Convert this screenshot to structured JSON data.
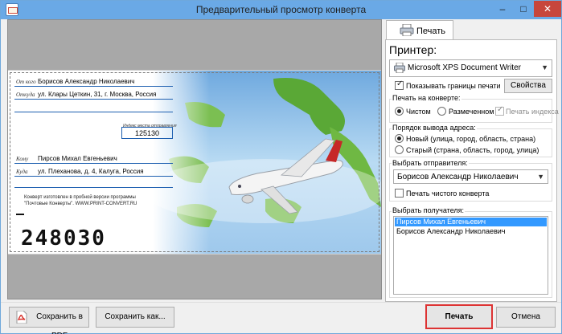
{
  "window": {
    "title": "Предварительный просмотр конверта",
    "minimize": "–",
    "maximize": "□",
    "close": "✕"
  },
  "envelope": {
    "from_label": "От кого",
    "from_value": "Борисов Александр Николаевич",
    "from_where_label": "Откуда",
    "from_where_value": "ул. Клары Цеткин, 31, г. Москва, Россия",
    "index_hint": "Индекс места отправления",
    "index_value": "125130",
    "to_label": "Кому",
    "to_value": "Пирсов Михал Евгеньевич",
    "to_where_label": "Куда",
    "to_where_value": "ул. Плеханова, д. 4, Калуга, Россия",
    "note_line1": "Конверт изготовлен в пробной версии программы",
    "note_line2": "\"Почтовые Конверты\". WWW.PRINT-CONVERT.RU",
    "postcode": "248030"
  },
  "tab": {
    "label": "Печать"
  },
  "printer": {
    "label": "Принтер:",
    "selected": "Microsoft XPS Document Writer",
    "show_borders_label": "Показывать границы печати",
    "show_borders_checked": true,
    "properties_button": "Свойства"
  },
  "print_on_envelope": {
    "title": "Печать на конверте:",
    "options": [
      "Чистом",
      "Размеченном"
    ],
    "selected_index": 0,
    "print_index_label": "Печать индекса",
    "print_index_checked": true
  },
  "address_order": {
    "title": "Порядок вывода адреса:",
    "options": [
      "Новый   (улица, город, область, страна)",
      "Старый (страна, область, город, улица)"
    ],
    "selected_index": 0
  },
  "sender": {
    "title": "Выбрать отправителя:",
    "selected": "Борисов Александр Николаевич",
    "blank_envelope_label": "Печать чистого конверта",
    "blank_envelope_checked": false
  },
  "recipient": {
    "title": "Выбрать получателя:",
    "items": [
      "Пирсов Михал Евгеньевич",
      "Борисов Александр Николаевич"
    ],
    "selected_index": 0
  },
  "bottom": {
    "save_pdf": "Сохранить в PDF",
    "save_as": "Сохранить как...",
    "print": "Печать",
    "cancel": "Отмена"
  },
  "colors": {
    "titlebar": "#6aa9e6",
    "accent_line": "#1d5fb0",
    "highlight": "#3399ff",
    "print_button_outline": "#dd3333"
  }
}
